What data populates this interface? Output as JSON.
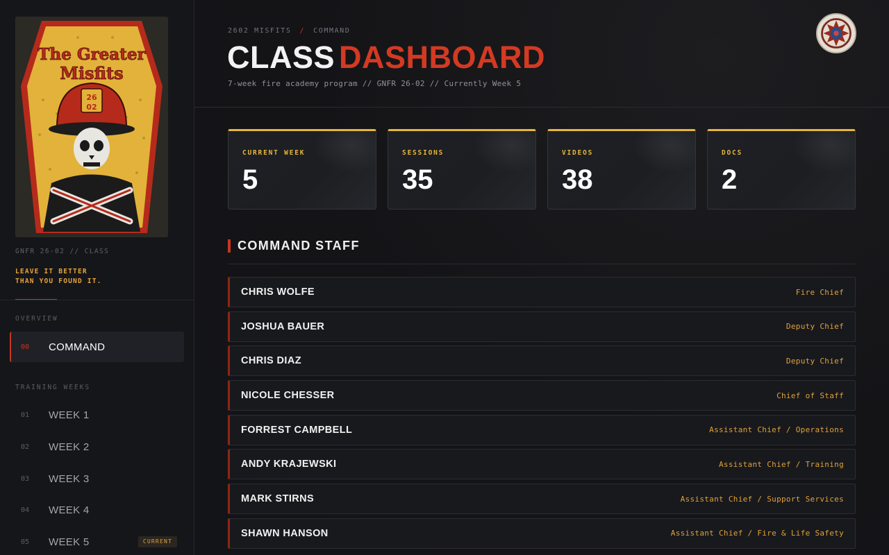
{
  "sidebar": {
    "patch": {
      "line1": "The Greater",
      "line2": "Misfits",
      "num_top": "26",
      "num_bottom": "02"
    },
    "class_tag": "GNFR 26-02 // CLASS",
    "motto": [
      "LEAVE IT BETTER",
      "THAN YOU FOUND IT."
    ],
    "overview_label": "OVERVIEW",
    "overview_items": [
      {
        "num": "00",
        "label": "COMMAND",
        "active": true
      }
    ],
    "weeks_label": "TRAINING WEEKS",
    "weeks": [
      {
        "num": "01",
        "label": "WEEK 1"
      },
      {
        "num": "02",
        "label": "WEEK 2"
      },
      {
        "num": "03",
        "label": "WEEK 3"
      },
      {
        "num": "04",
        "label": "WEEK 4"
      },
      {
        "num": "05",
        "label": "WEEK 5",
        "badge": "CURRENT"
      }
    ]
  },
  "header": {
    "breadcrumb": [
      "2602 MISFITS",
      "COMMAND"
    ],
    "breadcrumb_sep": "/",
    "title_part1": "CLASS",
    "title_part2": "DASHBOARD",
    "subtitle": "7-week fire academy program // GNFR 26-02 // Currently Week 5"
  },
  "stats": [
    {
      "label": "CURRENT WEEK",
      "value": "5"
    },
    {
      "label": "SESSIONS",
      "value": "35"
    },
    {
      "label": "VIDEOS",
      "value": "38"
    },
    {
      "label": "DOCS",
      "value": "2"
    }
  ],
  "staff_section": {
    "title": "COMMAND STAFF",
    "members": [
      {
        "name": "CHRIS WOLFE",
        "role": "Fire Chief"
      },
      {
        "name": "JOSHUA BAUER",
        "role": "Deputy Chief"
      },
      {
        "name": "CHRIS DIAZ",
        "role": "Deputy Chief"
      },
      {
        "name": "NICOLE CHESSER",
        "role": "Chief of Staff"
      },
      {
        "name": "FORREST CAMPBELL",
        "role": "Assistant Chief / Operations"
      },
      {
        "name": "ANDY KRAJEWSKI",
        "role": "Assistant Chief / Training"
      },
      {
        "name": "MARK STIRNS",
        "role": "Assistant Chief / Support Services"
      },
      {
        "name": "SHAWN HANSON",
        "role": "Assistant Chief / Fire & Life Safety"
      }
    ]
  },
  "colors": {
    "accent_red": "#c8361f",
    "accent_gold": "#e6b53a",
    "role_orange": "#e0a13a"
  }
}
